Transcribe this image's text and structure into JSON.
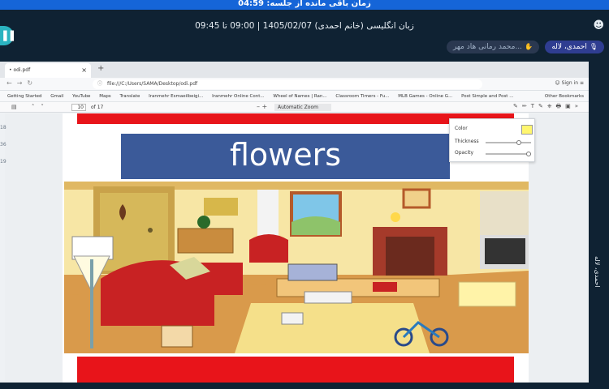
{
  "timer": "زمان باقی مانده از جلسه: 04:59",
  "session": {
    "title": "زبان انگلیسی (خانم احمدی) 1405/02/07 | 09:00 تا 09:45"
  },
  "participants": {
    "me": "احمدی، لاله",
    "other": "محمد رمانی هاد مهر..."
  },
  "side_label": "احمدی، لاله",
  "left_strip": [
    "18",
    "36",
    "19"
  ],
  "browser": {
    "tab_label": "• odi.pdf",
    "url": "file:///C:/Users/SAMA/Desktop/odi.pdf",
    "signin": "Sign in",
    "bookmarks": [
      "Getting Started",
      "Gmail",
      "YouTube",
      "Maps",
      "Translate",
      "Iranmehr Esmaeilbeigi...",
      "Iranmehr Online Cont...",
      "Wheel of Names | Ran...",
      "Classroom Timers - Fu...",
      "MLB Games - Online G...",
      "Post Simple and Post ..."
    ],
    "other_bookmarks": "Other Bookmarks"
  },
  "pdf": {
    "page_current": "10",
    "page_total": "of 17",
    "zoom": "Automatic Zoom",
    "title": "flowers"
  },
  "highlight_popup": {
    "color_label": "Color",
    "thickness_label": "Thickness",
    "opacity_label": "Opacity",
    "color": "#fff66f",
    "thickness": 0.75,
    "opacity": 1.0
  },
  "colors": {
    "app_bg": "#0f2233",
    "timer_bar": "#1565d8",
    "red_band": "#e8141a",
    "title_box": "#3b5a99"
  }
}
